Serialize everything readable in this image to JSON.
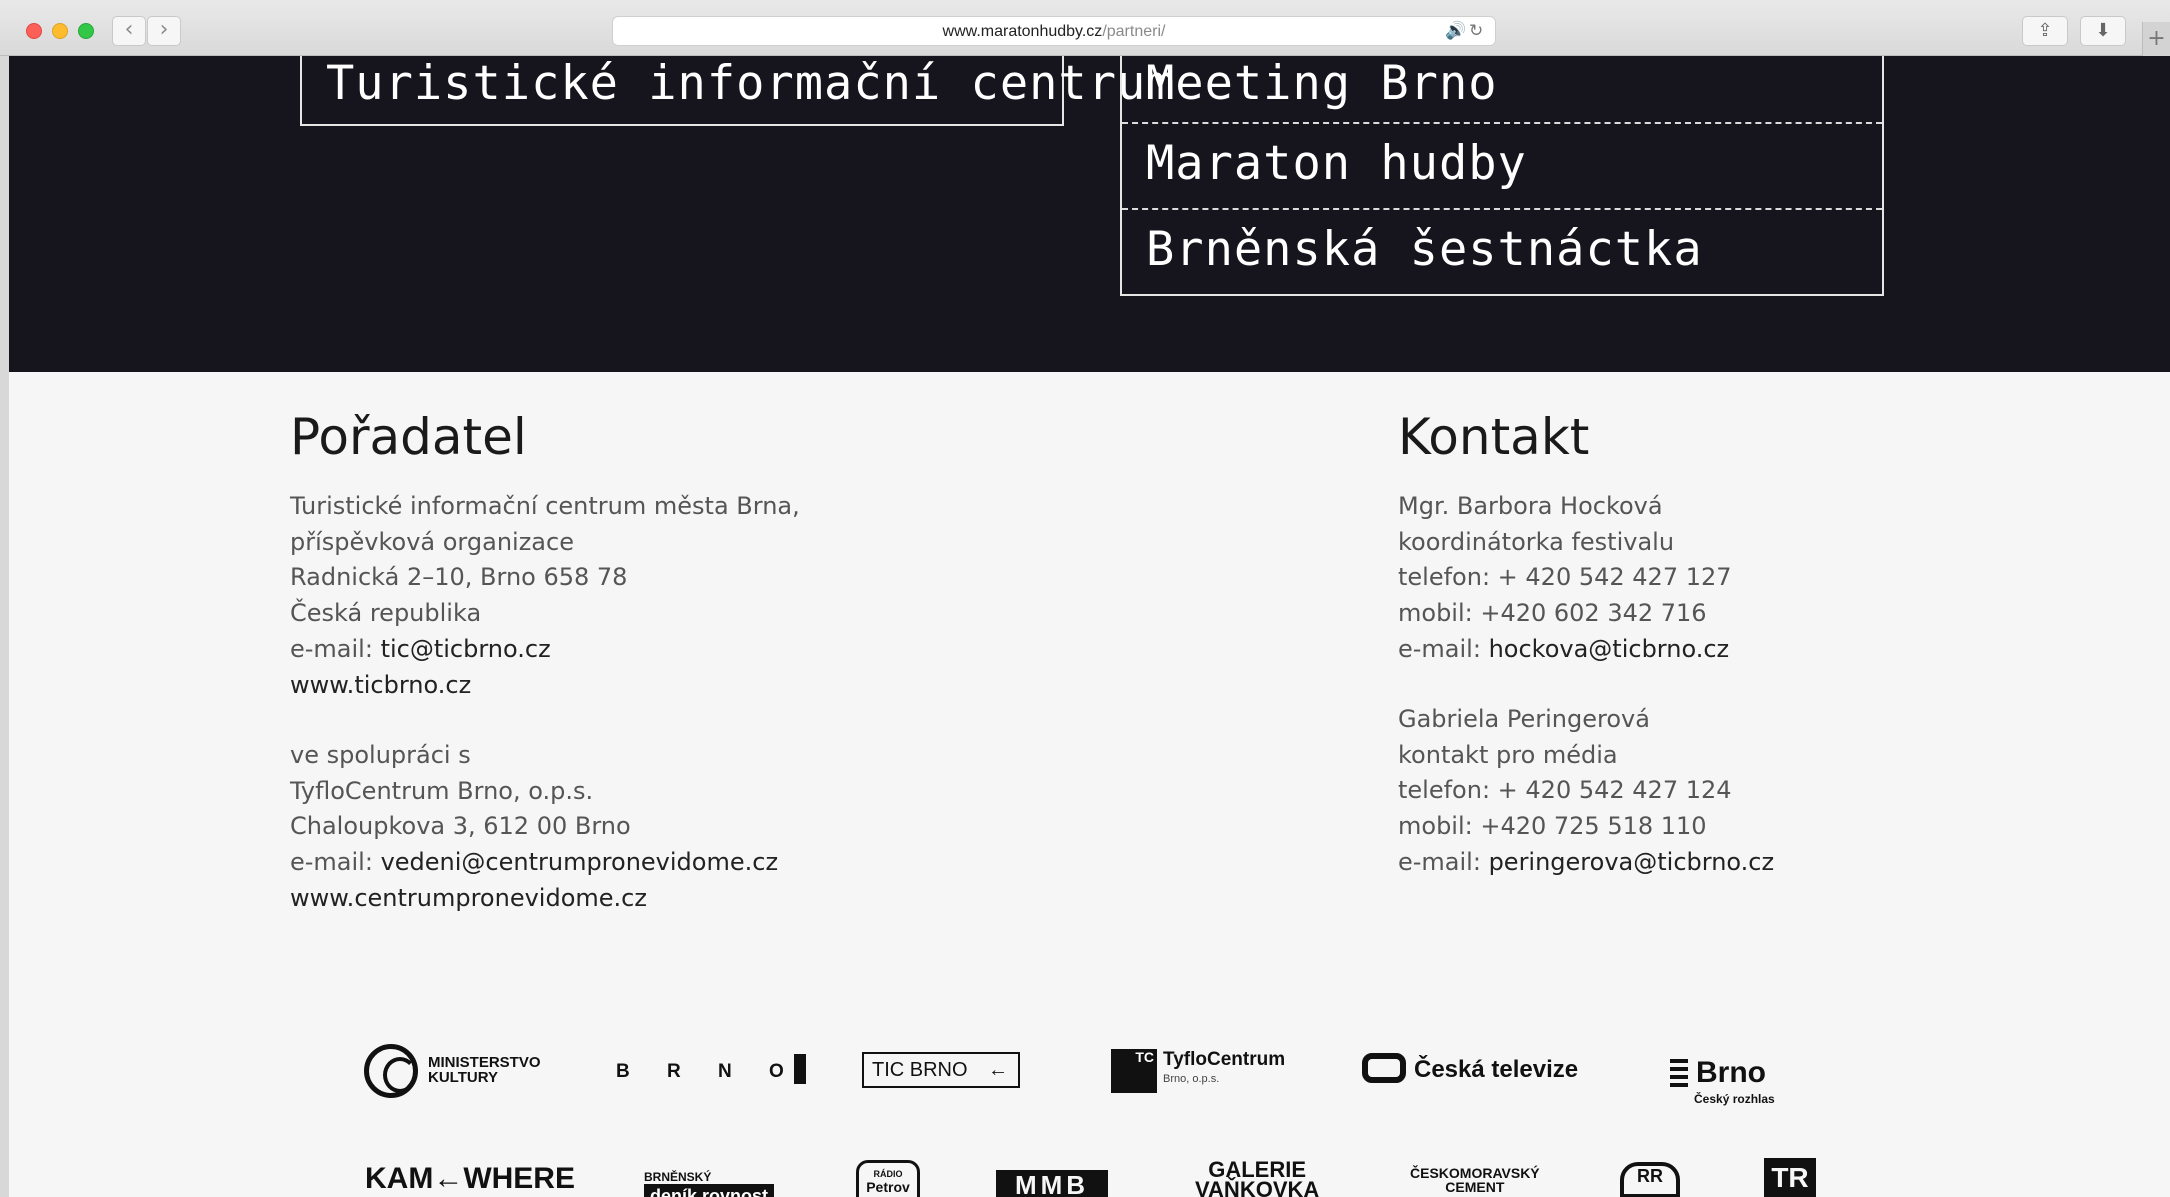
{
  "browser": {
    "url_host": "www.maratonhudby.cz",
    "url_path": "/partneri/",
    "back_icon": "chevron-left-icon",
    "forward_icon": "chevron-right-icon"
  },
  "dark_section": {
    "left_box": "Turistické informační centrum",
    "right_box": [
      "Meeting Brno",
      "Maraton hudby",
      "Brněnská šestnáctka"
    ]
  },
  "poradatel": {
    "heading": "Pořadatel",
    "lines": [
      "Turistické informační centrum města Brna,",
      "příspěvková organizace",
      "Radnická 2–10, Brno 658 78",
      "Česká republika"
    ],
    "email_label": "e-mail: ",
    "email": "tic@ticbrno.cz",
    "web": "www.ticbrno.cz",
    "coop_lines": [
      "ve spolupráci s",
      "TyfloCentrum Brno, o.p.s.",
      "Chaloupkova 3, 612 00 Brno"
    ],
    "coop_email_label": "e-mail: ",
    "coop_email": "vedeni@centrumpronevidome.cz",
    "coop_web": "www.centrumpronevidome.cz"
  },
  "kontakt": {
    "heading": "Kontakt",
    "person1": {
      "name": "Mgr. Barbora Hocková",
      "role": "koordinátorka festivalu",
      "phone": "telefon: + 420 542 427 127",
      "mobile": "mobil: +420 602 342 716",
      "email_label": "e-mail: ",
      "email": "hockova@ticbrno.cz"
    },
    "person2": {
      "name": "Gabriela Peringerová",
      "role": "kontakt pro média",
      "phone": "telefon: + 420 542 427 124",
      "mobile": "mobil: +420 725 518 110",
      "email_label": "e-mail: ",
      "email": "peringerova@ticbrno.cz"
    }
  },
  "logos": {
    "row1": {
      "ministerstvo_l1": "MINISTERSTVO",
      "ministerstvo_l2": "KULTURY",
      "brno": "B R N O",
      "tic": "TIC BRNO",
      "tic_arrow": "←",
      "tyflo": "TyfloCentrum",
      "tyflo_sub": "Brno, o.p.s.",
      "tyflo_tc": "TC",
      "ct": "Česká televize",
      "cro": "Brno",
      "cro_sub": "Český rozhlas"
    },
    "row2": {
      "kamewhere": "KAM←WHERE",
      "denik_top": "BRNĚNSKÝ",
      "denik": "deník rovnost",
      "petrov_top": "RÁDIO",
      "petrov": "Petrov",
      "mmb": "MMB",
      "vankovka_l1": "GALERIE",
      "vankovka_l2": "VAŇKOVKA",
      "cmc_l1": "ČESKOMORAVSKÝ",
      "cmc_l2": "CEMENT",
      "rr": "RR",
      "jr": "TR"
    }
  },
  "colors": {
    "dark_bg": "#16141d",
    "light_bg": "#f6f6f6",
    "text": "#555555"
  }
}
